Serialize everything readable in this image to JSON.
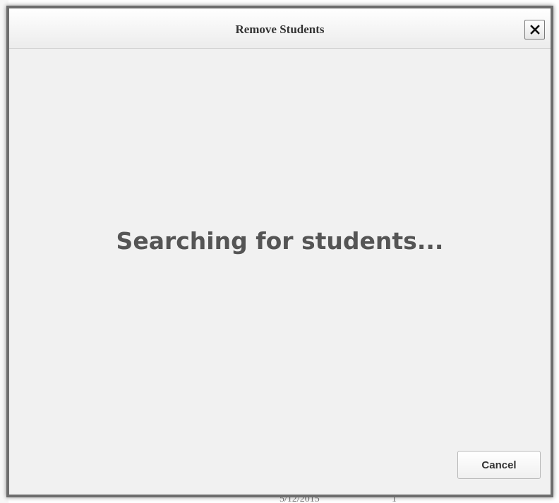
{
  "dialog": {
    "title": "Remove Students",
    "close_label": "✕",
    "status_message": "Searching for students...",
    "cancel_label": "Cancel"
  },
  "background": {
    "bottom_date": "5/12/2015",
    "bottom_value": "1"
  }
}
